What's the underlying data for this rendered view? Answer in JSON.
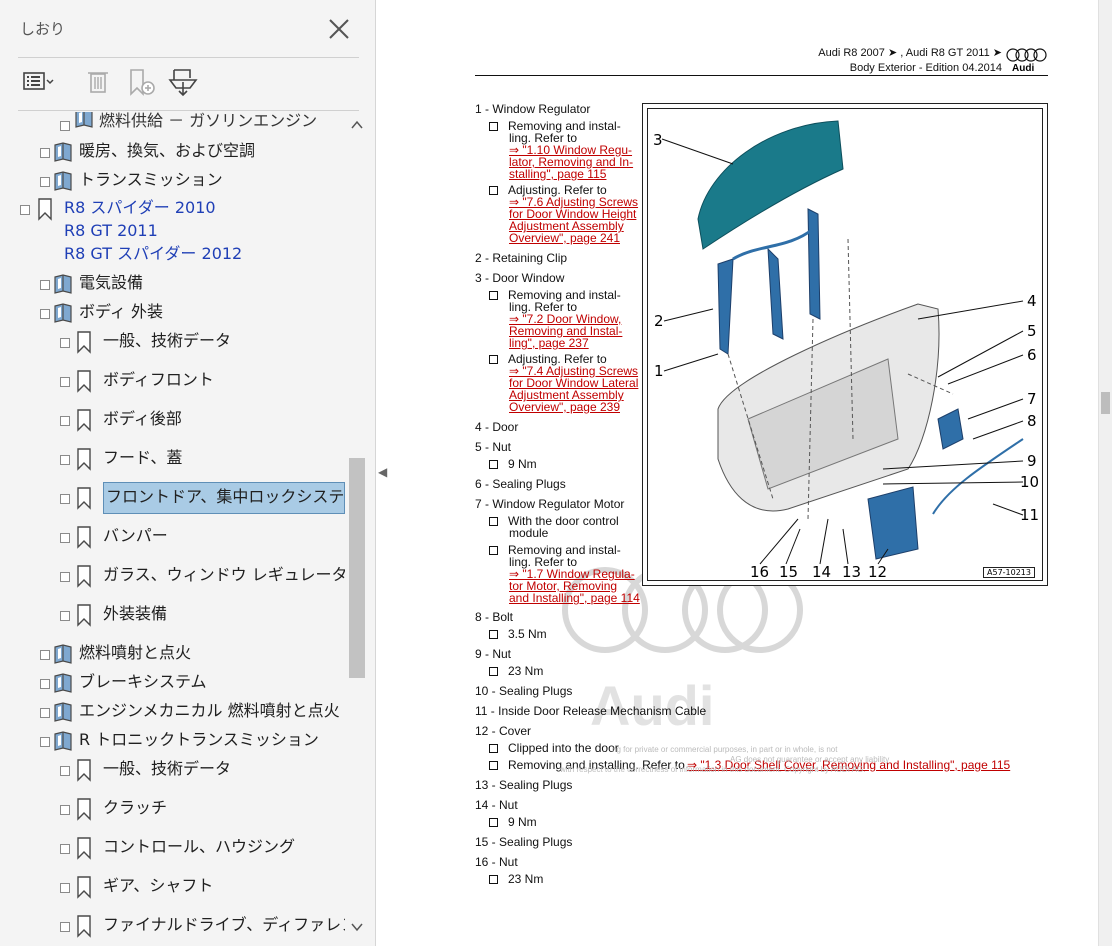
{
  "bookmarks_panel": {
    "title": "しおり",
    "items": [
      {
        "label": "燃料供給 － ガソリンエンジン",
        "level": 2
      },
      {
        "label": "暖房、換気、および空調",
        "level": 1
      },
      {
        "label": "トランスミッション",
        "level": 1
      },
      {
        "label": "R8 スパイダー 2010",
        "level": 0
      },
      {
        "label": "R8 GT 2011",
        "level": 0
      },
      {
        "label": "R8 GT スパイダー 2012",
        "level": 0
      },
      {
        "label": "電気設備",
        "level": 1
      },
      {
        "label": "ボディ 外装",
        "level": 1
      },
      {
        "label": "一般、技術データ",
        "level": 2
      },
      {
        "label": "ボディフロント",
        "level": 2
      },
      {
        "label": "ボディ後部",
        "level": 2
      },
      {
        "label": "フード、蓋",
        "level": 2
      },
      {
        "label": "フロントドア、集中ロックシステム",
        "level": 2
      },
      {
        "label": "バンパー",
        "level": 2
      },
      {
        "label": "ガラス、ウィンドウ レギュレーター",
        "level": 2
      },
      {
        "label": "外装装備",
        "level": 2
      },
      {
        "label": "燃料噴射と点火",
        "level": 1
      },
      {
        "label": "ブレーキシステム",
        "level": 1
      },
      {
        "label": "エンジンメカニカル 燃料噴射と点火",
        "level": 1
      },
      {
        "label": "R トロニックトランスミッション",
        "level": 1
      },
      {
        "label": "一般、技術データ",
        "level": 2
      },
      {
        "label": "クラッチ",
        "level": 2
      },
      {
        "label": "コントロール、ハウジング",
        "level": 2
      },
      {
        "label": "ギア、シャフト",
        "level": 2
      },
      {
        "label": "ファイナルドライブ、ディファレンシャル",
        "level": 2
      }
    ]
  },
  "document": {
    "header_line1": "Audi R8 2007 ➤ , Audi R8 GT 2011 ➤",
    "header_line2": "Body Exterior - Edition 04.2014",
    "logo_text": "Audi",
    "parts": [
      {
        "title": "1 - Window Regulator"
      },
      {
        "title": "2 - Retaining Clip"
      },
      {
        "title": "3 - Door Window"
      },
      {
        "title": "4 - Door"
      },
      {
        "title": "5 - Nut"
      },
      {
        "title": "6 - Sealing Plugs"
      },
      {
        "title": "7 - Window Regulator Motor"
      },
      {
        "title": "8 - Bolt"
      },
      {
        "title": "9 - Nut"
      },
      {
        "title": "10 - Sealing Plugs"
      },
      {
        "title": "11 - Inside Door Release Mechanism Cable"
      },
      {
        "title": "12 - Cover"
      },
      {
        "title": "13 - Sealing Plugs"
      },
      {
        "title": "14 - Nut"
      },
      {
        "title": "15 - Sealing Plugs"
      },
      {
        "title": "16 - Nut"
      }
    ],
    "subs": {
      "p1a": "Removing and instal-",
      "p1a2": "ling. Refer to",
      "p1a_link": [
        "⇒ \"1.10 Window Regu-",
        "lator, Removing and In-",
        "stalling\", page 115"
      ],
      "p1b": "Adjusting. Refer to",
      "p1b_link": [
        "⇒ \"7.6 Adjusting Screws",
        "for Door Window Height",
        "Adjustment Assembly",
        "Overview\", page 241"
      ],
      "p3a": "Removing and instal-",
      "p3a2": "ling. Refer to",
      "p3a_link": [
        "⇒ \"7.2 Door Window,",
        "Removing and Instal-",
        "ling\", page 237"
      ],
      "p3b": "Adjusting. Refer to",
      "p3b_link": [
        "⇒ \"7.4 Adjusting Screws",
        "for Door Window Lateral",
        "Adjustment Assembly",
        "Overview\", page 239"
      ],
      "p5": "9 Nm",
      "p7a": "With the door control",
      "p7a2": "module",
      "p7b": "Removing and instal-",
      "p7b2": "ling. Refer to",
      "p7b_link": [
        "⇒ \"1.7 Window Regula-",
        "tor Motor, Removing",
        "and Installing\", page 114"
      ],
      "p8": "3.5 Nm",
      "p9": "23 Nm",
      "p12a": "Clipped into the door",
      "p12b": "Removing and installing. Refer to",
      "p12b_link": "⇒ \"1.3 Door Shell Cover, Removing and Installing\", page 115",
      "p14": "9 Nm",
      "p16": "23 Nm"
    },
    "figure": {
      "callouts": [
        "1",
        "2",
        "3",
        "4",
        "5",
        "6",
        "7",
        "8",
        "9",
        "10",
        "11",
        "12",
        "13",
        "14",
        "15",
        "16"
      ],
      "code": "A57-10213"
    },
    "watermark_text": [
      "ng for private or commercial purposes, in part or in whole, is not",
      "AG does not guarantee or accept any liability",
      "with respect to the correctness of information in this document. Copyright by AUDI AG."
    ]
  },
  "colors": {
    "selected_bg": "#a9cbe5",
    "link": "#c00000",
    "r8_blue": "#1f3fb6"
  }
}
